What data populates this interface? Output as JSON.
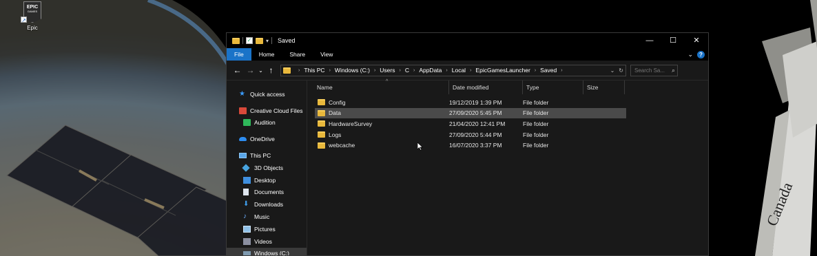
{
  "desktop": {
    "icon": {
      "logo_text": "EPIC",
      "logo_sub": "GAMES",
      "label": "Epic",
      "icon": "epic-games-icon"
    },
    "colors": {
      "earth": "#6f6a60",
      "space": "#000000"
    }
  },
  "window": {
    "title": "Saved",
    "controls": {
      "minimize": "—",
      "maximize": "☐",
      "close": "✕"
    },
    "ribbon": {
      "tabs": [
        "File",
        "Home",
        "Share",
        "View"
      ],
      "accent": "#1a73c8"
    },
    "nav": {
      "back": "←",
      "forward": "→",
      "recent": "⌄",
      "up": "↑"
    },
    "address": {
      "crumbs": [
        "This PC",
        "Windows (C:)",
        "Users",
        "C",
        "AppData",
        "Local",
        "EpicGamesLauncher",
        "Saved"
      ]
    },
    "search": {
      "placeholder": "Search Sa..."
    },
    "nav_pane": [
      {
        "label": "Quick access",
        "icon": "star-icon",
        "level": 1
      },
      {
        "label": "Creative Cloud Files",
        "icon": "creative-cloud-icon",
        "level": 1
      },
      {
        "label": "Audition",
        "icon": "audition-icon",
        "level": 2
      },
      {
        "label": "OneDrive",
        "icon": "onedrive-icon",
        "level": 1
      },
      {
        "label": "This PC",
        "icon": "this-pc-icon",
        "level": 1
      },
      {
        "label": "3D Objects",
        "icon": "3d-objects-icon",
        "level": 2
      },
      {
        "label": "Desktop",
        "icon": "desktop-icon",
        "level": 2
      },
      {
        "label": "Documents",
        "icon": "documents-icon",
        "level": 2
      },
      {
        "label": "Downloads",
        "icon": "downloads-icon",
        "level": 2
      },
      {
        "label": "Music",
        "icon": "music-icon",
        "level": 2
      },
      {
        "label": "Pictures",
        "icon": "pictures-icon",
        "level": 2
      },
      {
        "label": "Videos",
        "icon": "videos-icon",
        "level": 2
      },
      {
        "label": "Windows (C:)",
        "icon": "drive-icon",
        "level": 2
      }
    ],
    "columns": [
      "Name",
      "Date modified",
      "Type",
      "Size"
    ],
    "files": [
      {
        "name": "Config",
        "date": "19/12/2019 1:39 PM",
        "type": "File folder",
        "size": ""
      },
      {
        "name": "Data",
        "date": "27/09/2020 5:45 PM",
        "type": "File folder",
        "size": ""
      },
      {
        "name": "HardwareSurvey",
        "date": "21/04/2020 12:41 PM",
        "type": "File folder",
        "size": ""
      },
      {
        "name": "Logs",
        "date": "27/09/2020 5:44 PM",
        "type": "File folder",
        "size": ""
      },
      {
        "name": "webcache",
        "date": "16/07/2020 3:37 PM",
        "type": "File folder",
        "size": ""
      }
    ],
    "folder_color": "#e8b83c"
  },
  "scene": {
    "arm_text": "Canada"
  }
}
